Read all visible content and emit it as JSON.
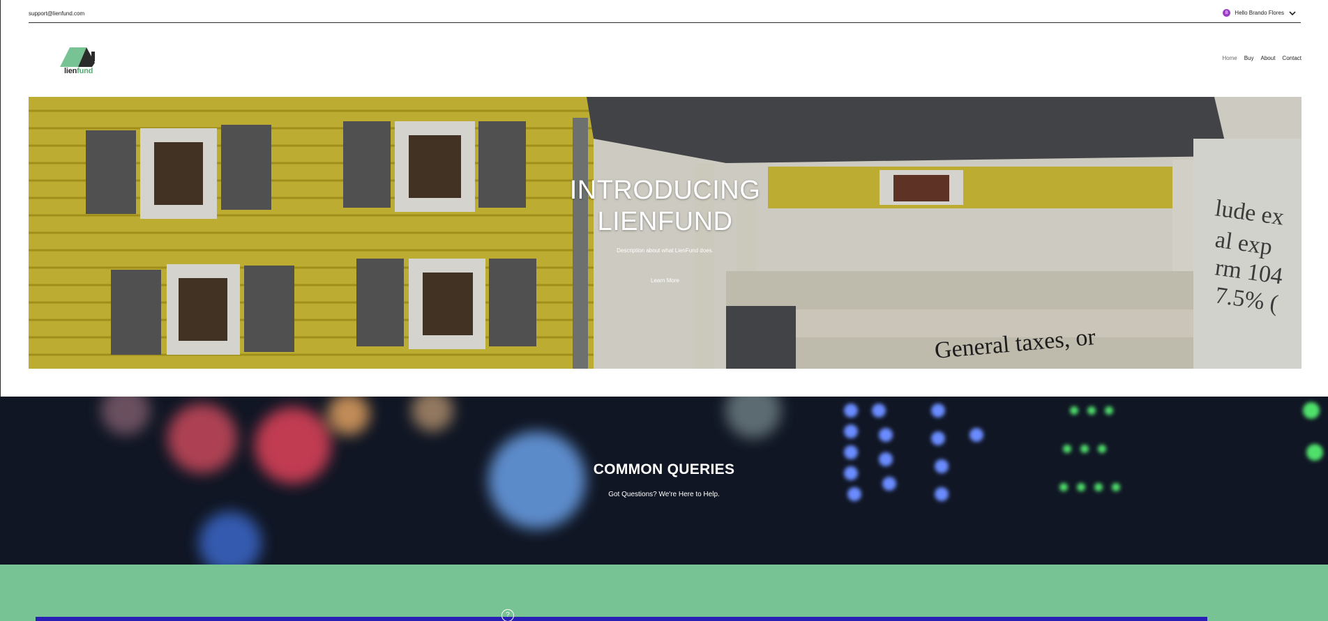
{
  "topbar": {
    "email": "support@lienfund.com",
    "greeting": "Hello Brando Flores",
    "avatar_initial": "B",
    "avatar_color": "#9b3fc9"
  },
  "logo": {
    "part1": "lien",
    "part2": "fund",
    "colors": {
      "roof": "#77c393",
      "dark": "#2b2b2b",
      "fund": "#4caf6e"
    }
  },
  "nav": {
    "items": [
      {
        "label": "Home",
        "active": true
      },
      {
        "label": "Buy"
      },
      {
        "label": "About"
      },
      {
        "label": "Contact"
      }
    ]
  },
  "hero": {
    "title_line1": "INTRODUCING",
    "title_line2": "LIENFUND",
    "description": "Description about what LienFund does.",
    "button_label": "Learn More"
  },
  "queries": {
    "title": "COMMON QUERIES",
    "subtitle": "Got Questions? We're Here to Help."
  },
  "footer_band": {
    "color": "#77c393",
    "help_icon": "question-icon"
  }
}
